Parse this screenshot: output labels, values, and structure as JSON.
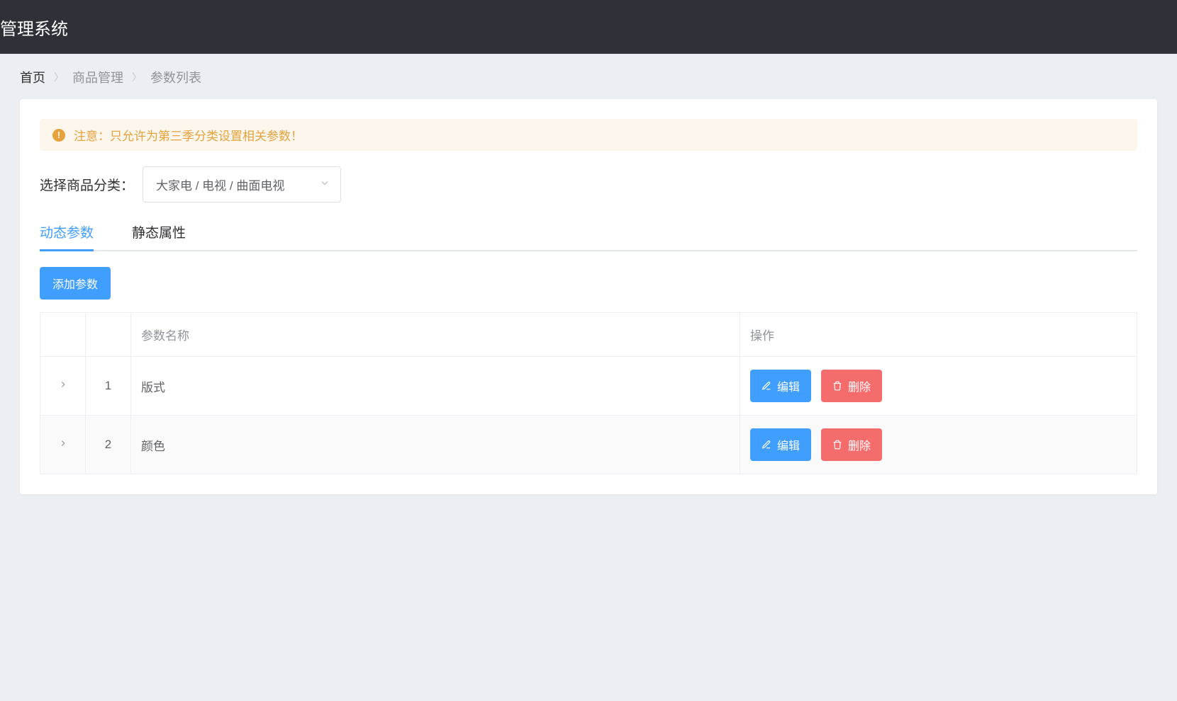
{
  "header": {
    "title": "管理系统"
  },
  "breadcrumb": {
    "home": "首页",
    "category": "商品管理",
    "page": "参数列表"
  },
  "alert": {
    "text": "注意：只允许为第三季分类设置相关参数！"
  },
  "selector": {
    "label": "选择商品分类：",
    "value": "大家电 / 电视 / 曲面电视"
  },
  "tabs": {
    "dynamic": "动态参数",
    "static": "静态属性"
  },
  "buttons": {
    "add": "添加参数",
    "edit": "编辑",
    "delete": "删除"
  },
  "table": {
    "columns": {
      "name": "参数名称",
      "actions": "操作"
    },
    "rows": [
      {
        "index": "1",
        "name": "版式"
      },
      {
        "index": "2",
        "name": "颜色"
      }
    ]
  }
}
